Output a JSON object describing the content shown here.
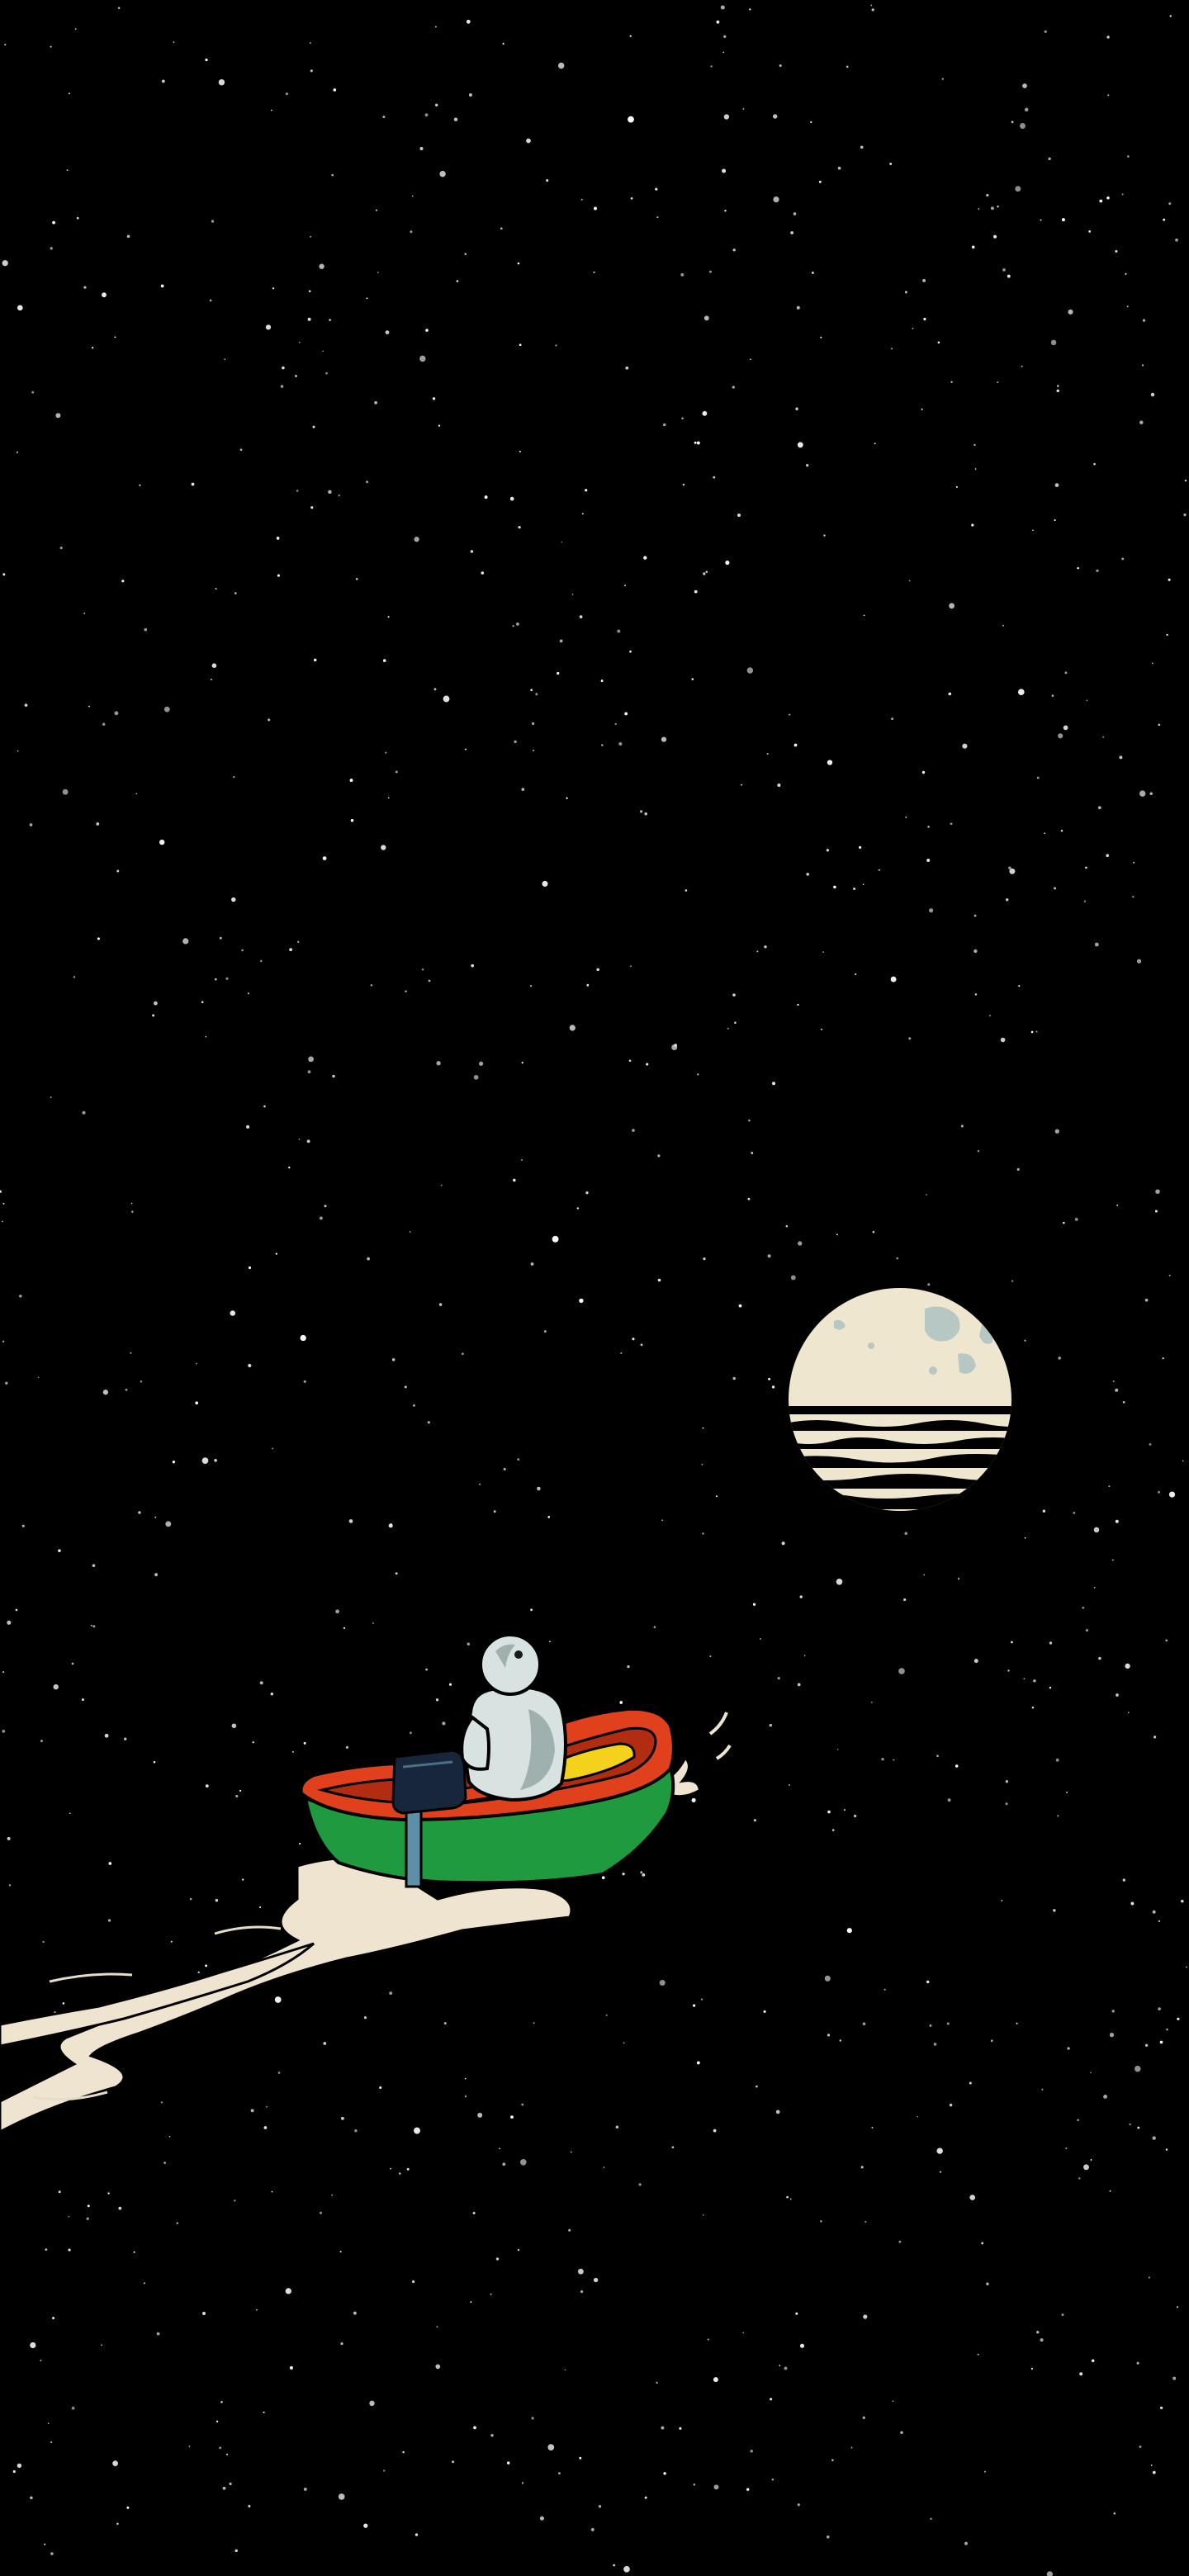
{
  "scene": {
    "type": "illustration",
    "subject": "astronaut-in-rowboat",
    "colors": {
      "sky": "#000000",
      "star": "#ffffff",
      "moon": "#efe6cf",
      "moon_crater": "#b7c7c3",
      "wake": "#efe4cf",
      "hull_green": "#1f9a3e",
      "hull_red": "#e0401c",
      "hull_red_dark": "#b22c12",
      "seat_yellow": "#f4d21b",
      "suit": "#d8e3e1",
      "suit_shadow": "#9fb0ae",
      "motor": "#17263a",
      "motor_shaft": "#5e8fa8",
      "outline": "#000000"
    }
  }
}
